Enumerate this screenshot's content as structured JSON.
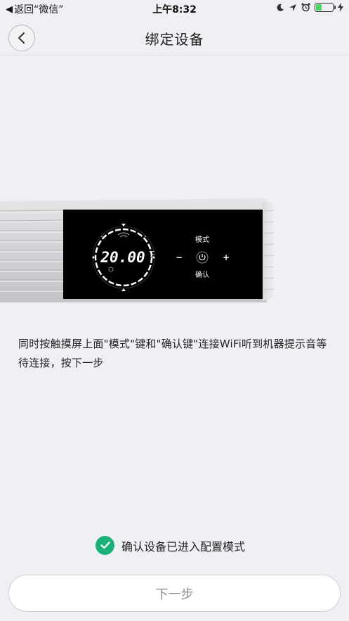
{
  "status_bar": {
    "back_app": "返回“微信”",
    "time": "上午8:32",
    "battery_level": 0.35
  },
  "nav": {
    "title": "绑定设备"
  },
  "device_panel": {
    "temperature": "20.00",
    "unit": "°C",
    "mode_label": "模式",
    "confirm_label": "确认",
    "minus": "−",
    "plus": "+"
  },
  "instruction": {
    "text": "同时按触摸屏上面\"模式\"键和\"确认键\"连接WiFi听到机器提示音等待连接，按下一步"
  },
  "confirm": {
    "label": "确认设备已进入配置模式",
    "checked": true
  },
  "next_button": {
    "label": "下一步"
  },
  "colors": {
    "background": "#eff0f4",
    "accent_green": "#1ab177",
    "battery_green": "#4cd964",
    "panel_black": "#000000"
  }
}
